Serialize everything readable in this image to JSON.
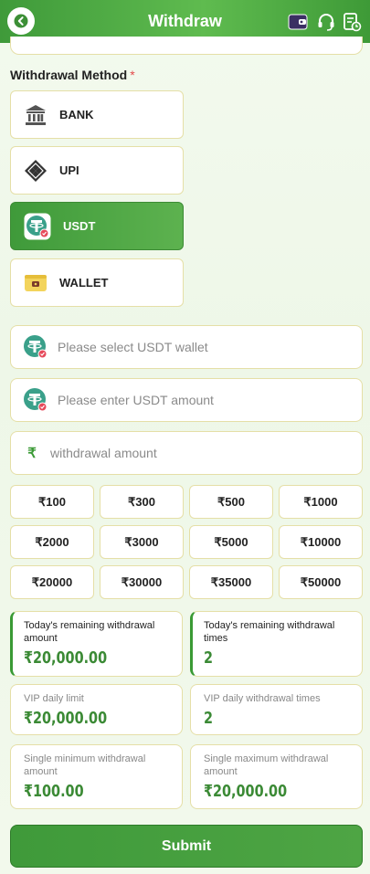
{
  "header": {
    "title": "Withdraw",
    "icons": [
      "back-icon",
      "wallet-icon",
      "headset-icon",
      "record-icon"
    ]
  },
  "withdrawal_method": {
    "label": "Withdrawal Method",
    "required_mark": "*",
    "options": [
      {
        "label": "BANK",
        "icon": "bank-icon",
        "selected": false
      },
      {
        "label": "UPI",
        "icon": "upi-icon",
        "selected": false
      },
      {
        "label": "USDT",
        "icon": "tether-icon",
        "selected": true
      },
      {
        "label": "WALLET",
        "icon": "wallet-icon",
        "selected": false
      }
    ]
  },
  "fields": {
    "usdt_wallet_placeholder": "Please select USDT wallet",
    "usdt_amount_placeholder": "Please enter USDT amount",
    "withdrawal_amount_placeholder": "withdrawal amount",
    "currency_symbol": "₹"
  },
  "amounts": [
    "₹100",
    "₹300",
    "₹500",
    "₹1000",
    "₹2000",
    "₹3000",
    "₹5000",
    "₹10000",
    "₹20000",
    "₹30000",
    "₹35000",
    "₹50000"
  ],
  "info": {
    "remaining_amount_label": "Today's remaining withdrawal amount",
    "remaining_amount_value": "₹20,000.00",
    "remaining_times_label": "Today's remaining withdrawal times",
    "remaining_times_value": "2",
    "vip_limit_label": "VIP daily limit",
    "vip_limit_value": "₹20,000.00",
    "vip_times_label": "VIP daily withdrawal times",
    "vip_times_value": "2",
    "min_label": "Single minimum withdrawal amount",
    "min_value": "₹100.00",
    "max_label": "Single maximum withdrawal amount",
    "max_value": "₹20,000.00"
  },
  "submit_label": "Submit",
  "colors": {
    "primary": "#3f9a3a",
    "accent_text": "#3b8a35",
    "border": "#e5dfa7",
    "required": "#e34b4b"
  }
}
